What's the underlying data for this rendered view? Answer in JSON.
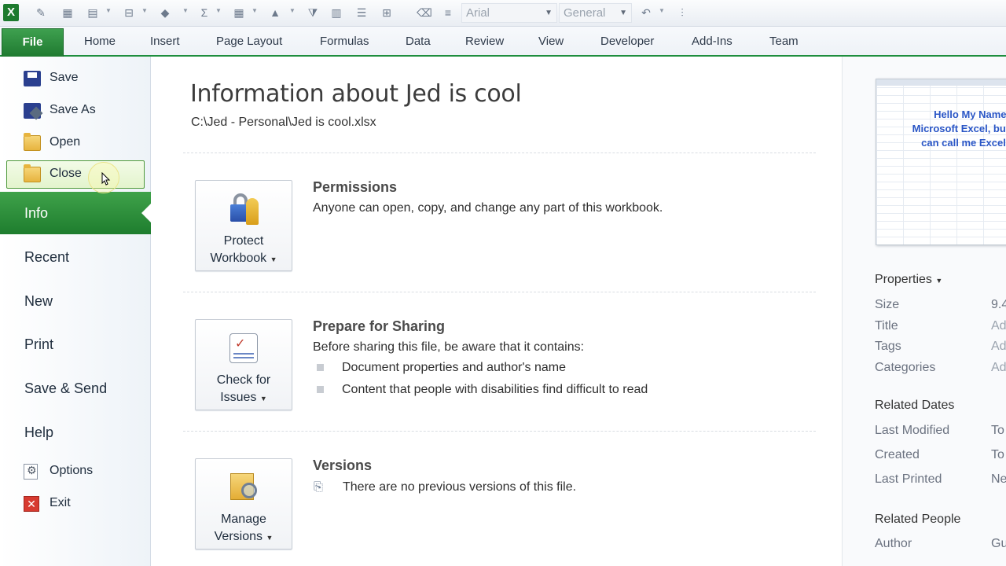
{
  "qat": {
    "font_name": "Arial",
    "number_format": "General"
  },
  "tabs": {
    "file": "File",
    "items": [
      "Home",
      "Insert",
      "Page Layout",
      "Formulas",
      "Data",
      "Review",
      "View",
      "Developer",
      "Add-Ins",
      "Team"
    ]
  },
  "nav": {
    "save": "Save",
    "save_as": "Save As",
    "open": "Open",
    "close": "Close",
    "info": "Info",
    "recent": "Recent",
    "new": "New",
    "print": "Print",
    "save_send": "Save & Send",
    "help": "Help",
    "options": "Options",
    "exit": "Exit"
  },
  "main": {
    "title": "Information about Jed is cool",
    "path": "C:\\Jed - Personal\\Jed is cool.xlsx",
    "permissions": {
      "button_line1": "Protect",
      "button_line2": "Workbook",
      "heading": "Permissions",
      "text": "Anyone can open, copy, and change any part of this workbook."
    },
    "sharing": {
      "button_line1": "Check for",
      "button_line2": "Issues",
      "heading": "Prepare for Sharing",
      "text": "Before sharing this file, be aware that it contains:",
      "bullets": [
        "Document properties and author's name",
        "Content that people with disabilities find difficult to read"
      ]
    },
    "versions": {
      "button_line1": "Manage",
      "button_line2": "Versions",
      "heading": "Versions",
      "text": "There are no previous versions of this file."
    }
  },
  "right": {
    "thumbnail_lines": [
      "Hello My Name Is",
      "Microsoft Excel, but y",
      "can call me Excelly!"
    ],
    "properties_heading": "Properties",
    "properties": [
      {
        "key": "Size",
        "value": "9.4"
      },
      {
        "key": "Title",
        "value": "Ad"
      },
      {
        "key": "Tags",
        "value": "Ad"
      },
      {
        "key": "Categories",
        "value": "Ad"
      }
    ],
    "related_dates_heading": "Related Dates",
    "related_dates": [
      {
        "key": "Last Modified",
        "value": "To"
      },
      {
        "key": "Created",
        "value": "To"
      },
      {
        "key": "Last Printed",
        "value": "Ne"
      }
    ],
    "related_people_heading": "Related People",
    "related_people": [
      {
        "key": "Author",
        "value": "Gu"
      }
    ]
  },
  "colors": {
    "accent_green": "#1e7d2e",
    "link_blue": "#2a56c6"
  }
}
